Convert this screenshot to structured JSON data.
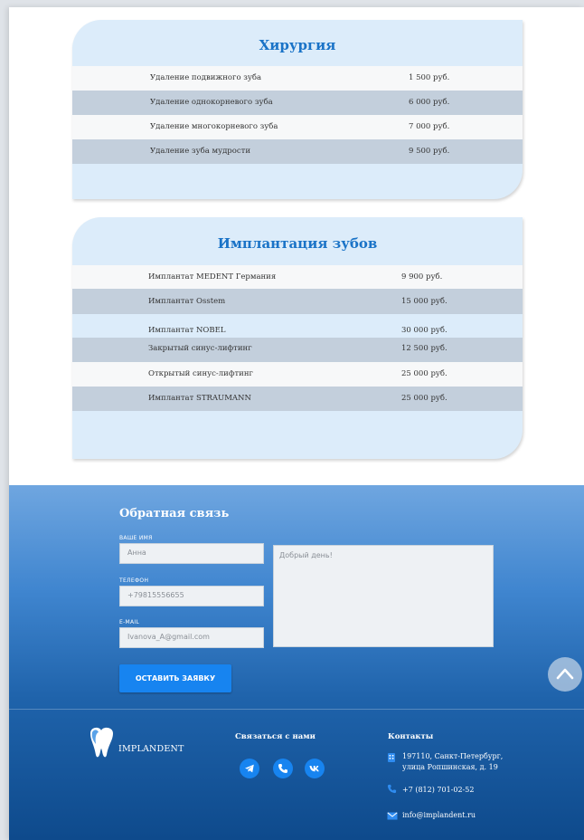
{
  "surgery": {
    "title": "Хирургия",
    "items": [
      {
        "name": "Удаление подвижного зуба",
        "price": "1 500 руб."
      },
      {
        "name": "Удаление однокорневого зуба",
        "price": "6 000 руб."
      },
      {
        "name": "Удаление многокорневого зуба",
        "price": "7 000 руб."
      },
      {
        "name": "Удаление зуба мудрости",
        "price": "9 500 руб."
      }
    ]
  },
  "implants": {
    "title": "Имплантация зубов",
    "items": [
      {
        "name": "Имплантат MEDENT Германия",
        "price": "9 900 руб."
      },
      {
        "name": "Имплантат Osstem",
        "price": "15 000 руб."
      },
      {
        "name": "Имплантат NOBEL",
        "price": "30 000 руб."
      },
      {
        "name": "Закрытый синус-лифтинг",
        "price": "12 500 руб."
      },
      {
        "name": "Открытый синус-лифтинг",
        "price": "25 000 руб."
      },
      {
        "name": "Имплантат STRAUMANN",
        "price": "25 000 руб."
      }
    ]
  },
  "feedback": {
    "title": "Обратная связь",
    "name_label": "ВАШЕ ИМЯ",
    "name_value": "Анна",
    "phone_label": "ТЕЛЕФОН",
    "phone_value": "+79815556655",
    "email_label": "E-MAIL",
    "email_value": "Ivanova_A@gmail.com",
    "message_value": "Добрый день!",
    "submit_label": "ОСТАВИТЬ ЗАЯВКУ"
  },
  "footer": {
    "logo_text": "IMPLANDENT",
    "contact_us_title": "Связаться с нами",
    "social_icons": [
      "telegram-icon",
      "phone-icon",
      "vk-icon"
    ],
    "contacts_title": "Контакты",
    "address_line1": "197110, Санкт-Петербург,",
    "address_line2": "улица Ропшинская, д. 19",
    "phone": "+7 (812) 701-02-52",
    "email": "info@implandent.ru"
  },
  "colors": {
    "accent": "#1784f0",
    "title_blue": "#1a73c7",
    "card_bg": "#dcecfa",
    "row_alt": "#c3cfdc"
  }
}
